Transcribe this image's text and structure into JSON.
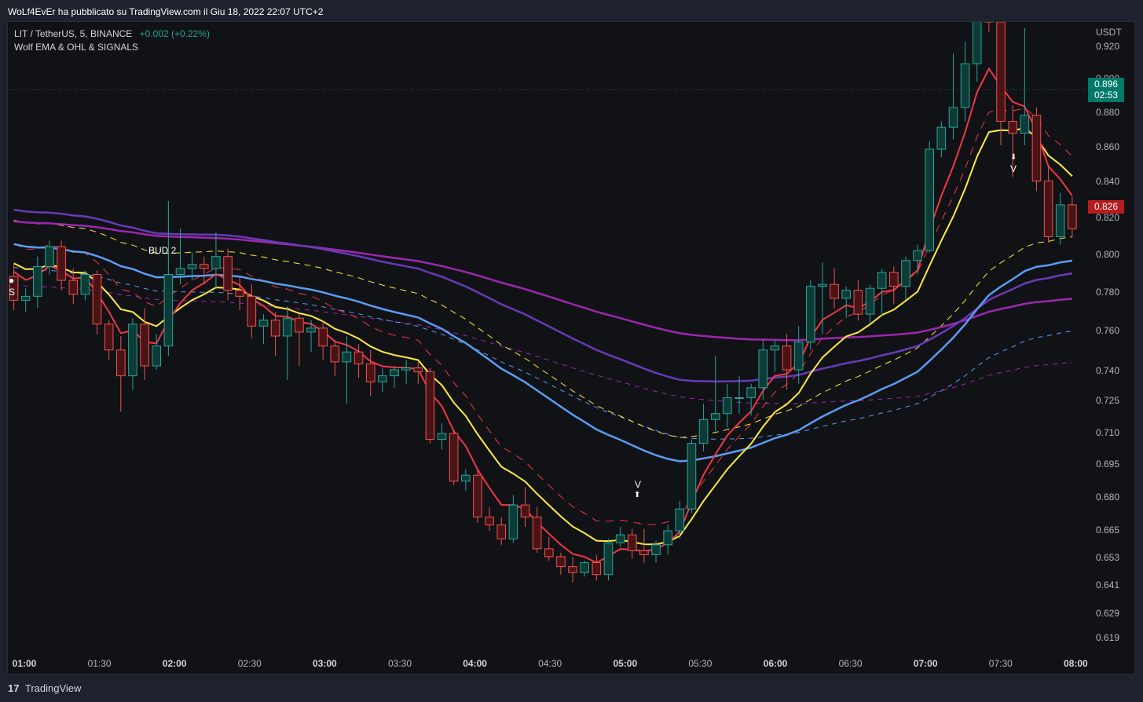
{
  "header": {
    "published": "WoLf4EvEr ha pubblicato su TradingView.com il Giu 18, 2022 22:07 UTC+2"
  },
  "legend": {
    "symbol": "LIT / TetherUS, 5, BINANCE",
    "change": "+0.002 (+0.22%)",
    "indicator": "Wolf EMA & OHL & SIGNALS"
  },
  "axis": {
    "currency": "USDT",
    "y_ticks": [
      "0.920",
      "0.900",
      "0.880",
      "0.860",
      "0.840",
      "0.820",
      "0.800",
      "0.780",
      "0.760",
      "0.740",
      "0.725",
      "0.710",
      "0.695",
      "0.680",
      "0.665",
      "0.653",
      "0.641",
      "0.629",
      "0.619"
    ],
    "x_ticks": [
      {
        "label": "01:00",
        "bold": true
      },
      {
        "label": "01:30",
        "bold": false
      },
      {
        "label": "02:00",
        "bold": true
      },
      {
        "label": "02:30",
        "bold": false
      },
      {
        "label": "03:00",
        "bold": true
      },
      {
        "label": "03:30",
        "bold": false
      },
      {
        "label": "04:00",
        "bold": true
      },
      {
        "label": "04:30",
        "bold": false
      },
      {
        "label": "05:00",
        "bold": true
      },
      {
        "label": "05:30",
        "bold": false
      },
      {
        "label": "06:00",
        "bold": true
      },
      {
        "label": "06:30",
        "bold": false
      },
      {
        "label": "07:00",
        "bold": true
      },
      {
        "label": "07:30",
        "bold": false
      },
      {
        "label": "08:00",
        "bold": true
      }
    ]
  },
  "badges": {
    "last_price": "0.896",
    "countdown": "02:53",
    "red_price": "0.826"
  },
  "signals": {
    "sell_start": "S",
    "v_low": "V",
    "v_high": "V",
    "bud": "BUD 2"
  },
  "footer": {
    "brand": "TradingView",
    "logo": "17"
  },
  "colors": {
    "up": "#26a69a",
    "down": "#ef5350",
    "ema_fast": "#f23645",
    "ema_mid": "#ffeb3b",
    "ema_slow": "#5b9cf6",
    "ema_purple": "#9c27b0",
    "ema_violet": "#673ab7"
  },
  "chart_data": {
    "type": "candlestick",
    "ylim": [
      0.612,
      0.93
    ],
    "candles_ohlc": [
      [
        0.802,
        0.808,
        0.785,
        0.79
      ],
      [
        0.79,
        0.796,
        0.784,
        0.792
      ],
      [
        0.792,
        0.812,
        0.786,
        0.807
      ],
      [
        0.807,
        0.82,
        0.803,
        0.817
      ],
      [
        0.817,
        0.82,
        0.795,
        0.8
      ],
      [
        0.8,
        0.806,
        0.788,
        0.793
      ],
      [
        0.793,
        0.805,
        0.79,
        0.803
      ],
      [
        0.803,
        0.805,
        0.773,
        0.778
      ],
      [
        0.778,
        0.78,
        0.76,
        0.765
      ],
      [
        0.765,
        0.772,
        0.734,
        0.752
      ],
      [
        0.752,
        0.781,
        0.745,
        0.778
      ],
      [
        0.778,
        0.786,
        0.75,
        0.757
      ],
      [
        0.757,
        0.773,
        0.755,
        0.767
      ],
      [
        0.767,
        0.84,
        0.762,
        0.803
      ],
      [
        0.803,
        0.826,
        0.798,
        0.806
      ],
      [
        0.806,
        0.814,
        0.8,
        0.808
      ],
      [
        0.808,
        0.812,
        0.798,
        0.806
      ],
      [
        0.806,
        0.824,
        0.796,
        0.812
      ],
      [
        0.812,
        0.816,
        0.79,
        0.795
      ],
      [
        0.795,
        0.802,
        0.785,
        0.792
      ],
      [
        0.792,
        0.798,
        0.771,
        0.777
      ],
      [
        0.777,
        0.783,
        0.768,
        0.78
      ],
      [
        0.78,
        0.784,
        0.762,
        0.772
      ],
      [
        0.772,
        0.787,
        0.75,
        0.781
      ],
      [
        0.781,
        0.783,
        0.757,
        0.774
      ],
      [
        0.774,
        0.78,
        0.764,
        0.776
      ],
      [
        0.776,
        0.78,
        0.76,
        0.767
      ],
      [
        0.767,
        0.77,
        0.752,
        0.759
      ],
      [
        0.759,
        0.772,
        0.738,
        0.764
      ],
      [
        0.764,
        0.768,
        0.751,
        0.758
      ],
      [
        0.758,
        0.765,
        0.742,
        0.749
      ],
      [
        0.749,
        0.756,
        0.744,
        0.752
      ],
      [
        0.752,
        0.757,
        0.746,
        0.755
      ],
      [
        0.755,
        0.76,
        0.748,
        0.756
      ],
      [
        0.756,
        0.759,
        0.748,
        0.754
      ],
      [
        0.754,
        0.756,
        0.718,
        0.72
      ],
      [
        0.72,
        0.728,
        0.715,
        0.723
      ],
      [
        0.723,
        0.725,
        0.697,
        0.699
      ],
      [
        0.699,
        0.705,
        0.694,
        0.702
      ],
      [
        0.702,
        0.705,
        0.678,
        0.681
      ],
      [
        0.681,
        0.686,
        0.674,
        0.677
      ],
      [
        0.677,
        0.681,
        0.667,
        0.67
      ],
      [
        0.67,
        0.692,
        0.668,
        0.687
      ],
      [
        0.687,
        0.696,
        0.676,
        0.681
      ],
      [
        0.681,
        0.686,
        0.663,
        0.665
      ],
      [
        0.665,
        0.671,
        0.659,
        0.661
      ],
      [
        0.661,
        0.663,
        0.652,
        0.656
      ],
      [
        0.656,
        0.661,
        0.648,
        0.653
      ],
      [
        0.653,
        0.659,
        0.651,
        0.658
      ],
      [
        0.658,
        0.662,
        0.649,
        0.652
      ],
      [
        0.652,
        0.67,
        0.649,
        0.668
      ],
      [
        0.668,
        0.676,
        0.666,
        0.672
      ],
      [
        0.672,
        0.675,
        0.66,
        0.664
      ],
      [
        0.664,
        0.675,
        0.658,
        0.662
      ],
      [
        0.662,
        0.669,
        0.658,
        0.667
      ],
      [
        0.667,
        0.677,
        0.662,
        0.674
      ],
      [
        0.674,
        0.689,
        0.67,
        0.685
      ],
      [
        0.685,
        0.72,
        0.683,
        0.718
      ],
      [
        0.718,
        0.738,
        0.714,
        0.73
      ],
      [
        0.73,
        0.762,
        0.724,
        0.733
      ],
      [
        0.733,
        0.748,
        0.726,
        0.741
      ],
      [
        0.741,
        0.752,
        0.733,
        0.741
      ],
      [
        0.741,
        0.748,
        0.732,
        0.746
      ],
      [
        0.746,
        0.77,
        0.74,
        0.765
      ],
      [
        0.765,
        0.77,
        0.754,
        0.767
      ],
      [
        0.767,
        0.773,
        0.745,
        0.755
      ],
      [
        0.755,
        0.777,
        0.748,
        0.769
      ],
      [
        0.769,
        0.8,
        0.765,
        0.797
      ],
      [
        0.797,
        0.809,
        0.773,
        0.798
      ],
      [
        0.798,
        0.806,
        0.786,
        0.791
      ],
      [
        0.791,
        0.797,
        0.781,
        0.795
      ],
      [
        0.795,
        0.8,
        0.78,
        0.783
      ],
      [
        0.783,
        0.798,
        0.778,
        0.796
      ],
      [
        0.796,
        0.806,
        0.782,
        0.804
      ],
      [
        0.804,
        0.807,
        0.788,
        0.797
      ],
      [
        0.797,
        0.812,
        0.79,
        0.81
      ],
      [
        0.81,
        0.818,
        0.803,
        0.815
      ],
      [
        0.815,
        0.87,
        0.814,
        0.866
      ],
      [
        0.866,
        0.88,
        0.862,
        0.877
      ],
      [
        0.877,
        0.914,
        0.871,
        0.887
      ],
      [
        0.887,
        0.92,
        0.88,
        0.909
      ],
      [
        0.909,
        0.931,
        0.9,
        0.935
      ],
      [
        0.935,
        0.938,
        0.925,
        0.93
      ],
      [
        0.93,
        0.935,
        0.868,
        0.88
      ],
      [
        0.88,
        0.888,
        0.852,
        0.874
      ],
      [
        0.874,
        0.927,
        0.868,
        0.883
      ],
      [
        0.883,
        0.887,
        0.845,
        0.85
      ],
      [
        0.85,
        0.858,
        0.819,
        0.822
      ],
      [
        0.822,
        0.844,
        0.818,
        0.838
      ],
      [
        0.838,
        0.842,
        0.822,
        0.826
      ]
    ],
    "signals": [
      {
        "label": "S",
        "bar": 0
      },
      {
        "label": "V",
        "bar": 50
      },
      {
        "label": "V",
        "bar": 84
      }
    ]
  }
}
